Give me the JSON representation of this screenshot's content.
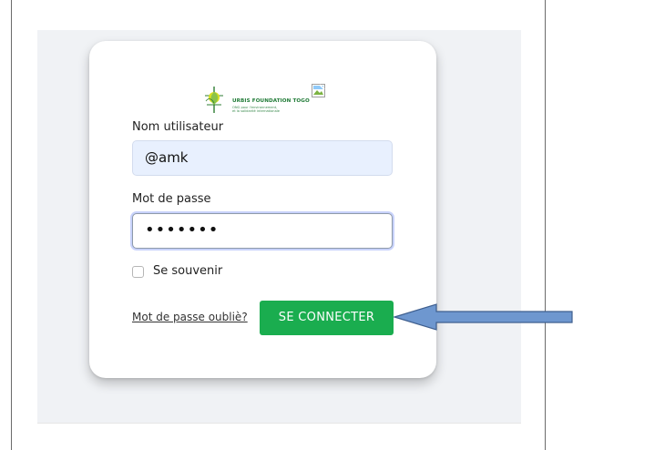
{
  "login": {
    "logo": {
      "title": "URBIS FOUNDATION TOGO",
      "subtitle_line1": "ONG pour l'environnement,",
      "subtitle_line2": "et la solidarité internationale"
    },
    "username": {
      "label": "Nom utilisateur",
      "value": "@amk"
    },
    "password": {
      "label": "Mot de passe",
      "value": "•••••••"
    },
    "remember": {
      "label": "Se souvenir",
      "checked": false
    },
    "forgot_link": "Mot de passe oubliè?",
    "submit_label": "SE CONNECTER"
  },
  "colors": {
    "primary_button": "#1aad4f",
    "annotation_arrow": "#6e97cf",
    "autofill_background": "#e8f0fe",
    "panel_background": "#f0f2f5"
  }
}
